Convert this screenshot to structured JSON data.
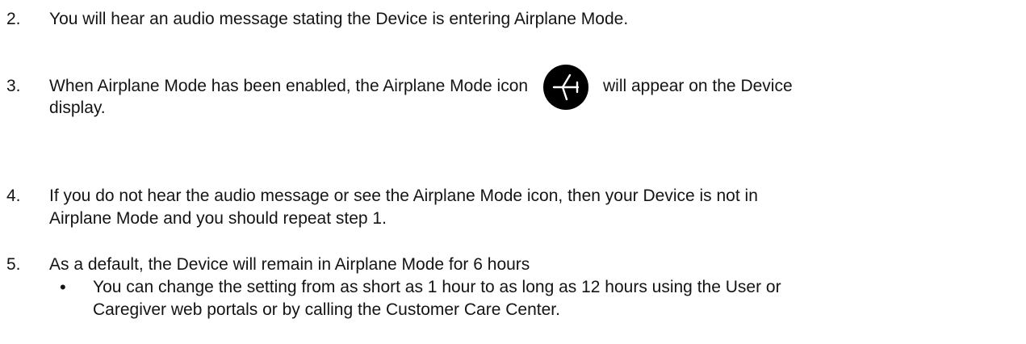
{
  "steps": [
    {
      "number": "2.",
      "text": "You will hear an audio message stating the Device is entering Airplane Mode."
    },
    {
      "number": "3.",
      "text_before_icon": "When Airplane Mode has been enabled, the Airplane Mode icon",
      "text_after_icon": "will appear on the Device",
      "text_line2": "display.",
      "icon": "airplane-mode-icon"
    },
    {
      "number": "4.",
      "text_line1": "If you do not hear the audio message or see the Airplane Mode icon, then your Device is not in",
      "text_line2": "Airplane Mode and you should repeat step 1."
    },
    {
      "number": "5.",
      "text": "As a default, the Device will remain in Airplane Mode for 6 hours",
      "sub_bullet": {
        "symbol": "•",
        "line1": "You can change the setting from as short as 1 hour to as long as 12 hours using the User or",
        "line2": "Caregiver web portals or by calling the Customer Care Center."
      }
    }
  ]
}
